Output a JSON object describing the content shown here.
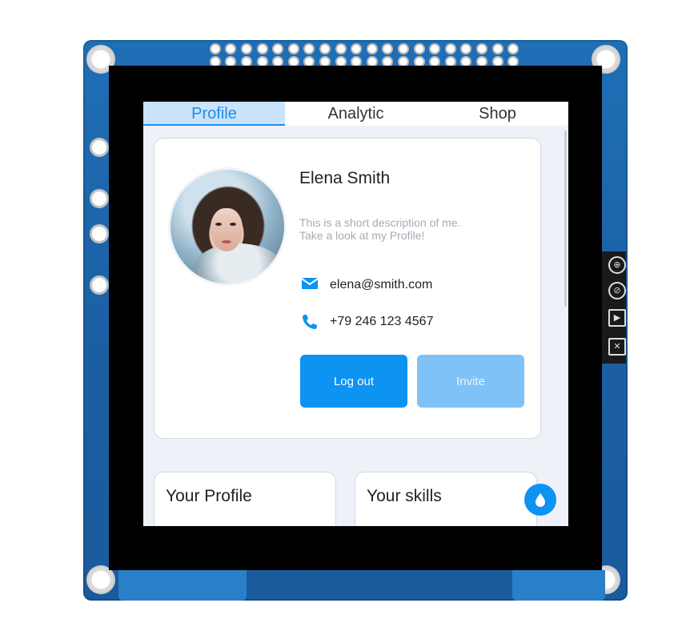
{
  "tabs": [
    {
      "label": "Profile",
      "active": true
    },
    {
      "label": "Analytic",
      "active": false
    },
    {
      "label": "Shop",
      "active": false
    }
  ],
  "profile": {
    "name": "Elena Smith",
    "description_line1": "This is a short description of me.",
    "description_line2": "Take a look at my Profile!",
    "email": "elena@smith.com",
    "phone": "+79 246 123 4567",
    "email_icon": "envelope-icon",
    "phone_icon": "phone-icon"
  },
  "buttons": {
    "logout": "Log out",
    "invite": "Invite"
  },
  "cards": {
    "your_profile": "Your Profile",
    "your_skills": "Your skills"
  },
  "fab_icon": "water-drop-icon",
  "colors": {
    "accent": "#0d93f2",
    "accent_light": "#7fc2f7",
    "tab_active_bg": "#c9e3fb",
    "screen_bg": "#eef1f8",
    "pcb_blue": "#1f6fb6"
  }
}
